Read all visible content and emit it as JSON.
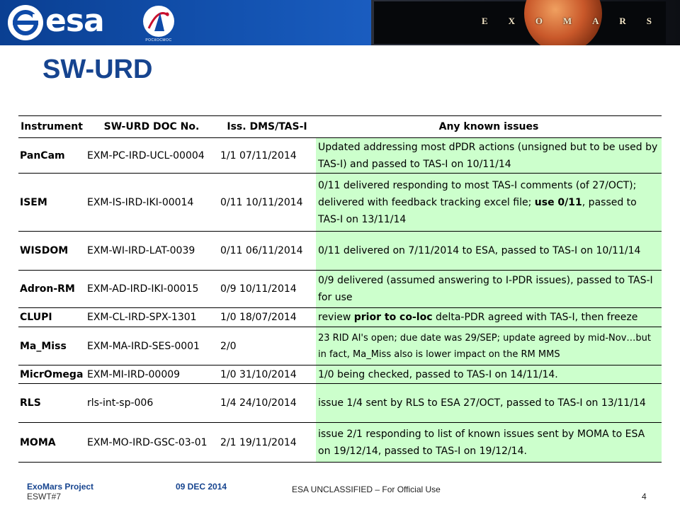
{
  "header": {
    "esa_wordmark": "esa",
    "roscosmos_text": "РОСКОСМОС",
    "exomars_letters": [
      "E",
      "X",
      "O",
      "M",
      "A",
      "R",
      "S"
    ]
  },
  "title": "SW-URD",
  "table": {
    "headers": [
      "Instrument",
      "SW-URD DOC No.",
      "Iss. DMS/TAS-I",
      "Any known issues"
    ],
    "rows": [
      {
        "instrument": "PanCam",
        "doc": "EXM-PC-IRD-UCL-00004",
        "iss": "1/1 07/11/2014",
        "issue": "Updated addressing most dPDR actions (unsigned but to be used by TAS-I) and passed to TAS-I on 10/11/14"
      },
      {
        "instrument": "ISEM",
        "doc": "EXM-IS-IRD-IKI-00014",
        "iss": "0/11 10/11/2014",
        "issue_pre": "0/11 delivered responding to most TAS-I comments (of 27/OCT); delivered with feedback tracking excel file; ",
        "issue_bold": "use 0/11",
        "issue_post": ", passed to TAS-I on 13/11/14"
      },
      {
        "instrument": "WISDOM",
        "doc": "EXM-WI-IRD-LAT-0039",
        "iss": "0/11 06/11/2014",
        "issue": "0/11 delivered on 7/11/2014 to ESA, passed to TAS-I on 10/11/14"
      },
      {
        "instrument": "Adron-RM",
        "doc": "EXM-AD-IRD-IKI-00015",
        "iss": "0/9 10/11/2014",
        "issue": "0/9 delivered (assumed answering to I-PDR issues), passed to TAS-I for use"
      },
      {
        "instrument": "CLUPI",
        "doc": "EXM-CL-IRD-SPX-1301",
        "iss": "1/0 18/07/2014",
        "issue_pre": "review ",
        "issue_bold": "prior to co-loc",
        "issue_post": " delta-PDR agreed with TAS-I, then freeze"
      },
      {
        "instrument": "Ma_Miss",
        "doc": "EXM-MA-IRD-SES-0001",
        "iss": "2/0",
        "issue": "23 RID AI's open; due date was 29/SEP; update agreed by mid-Nov…but in fact, Ma_Miss also is lower impact on the RM MMS"
      },
      {
        "instrument": "MicrOmega",
        "doc": "EXM-MI-IRD-00009",
        "iss": "1/0 31/10/2014",
        "issue": "1/0 being checked, passed to TAS-I on 14/11/14."
      },
      {
        "instrument": "RLS",
        "doc": "rls-int-sp-006",
        "iss": "1/4 24/10/2014",
        "issue": "issue 1/4 sent by RLS to ESA 27/OCT, passed to TAS-I on 13/11/14"
      },
      {
        "instrument": "MOMA",
        "doc": "EXM-MO-IRD-GSC-03-01",
        "iss": "2/1 19/11/2014",
        "issue": "issue 2/1 responding to list of known issues sent by MOMA to ESA on 19/12/14, passed to TAS-I on 19/12/14."
      }
    ]
  },
  "footer": {
    "project": "ExoMars Project",
    "meeting": "ESWT#7",
    "date": "09 DEC 2014",
    "classification": "ESA UNCLASSIFIED – For Official Use",
    "page": "4"
  },
  "colors": {
    "banner_blue": "#1352b0",
    "title_blue": "#16448f",
    "issue_green": "#ccffcc"
  }
}
